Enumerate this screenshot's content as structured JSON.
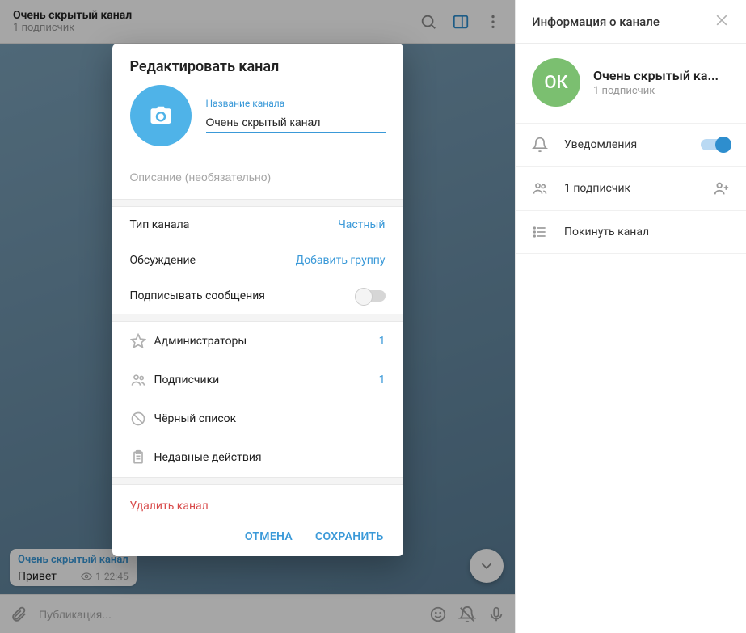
{
  "header": {
    "title": "Очень скрытый канал",
    "subscribers": "1 подписчик"
  },
  "message": {
    "channel": "Очень скрытый канал",
    "text": "Привет",
    "views": "1",
    "time": "22:45"
  },
  "composer": {
    "placeholder": "Публикация..."
  },
  "side": {
    "title": "Информация о канале",
    "avatar_text": "ОК",
    "name": "Очень скрытый ка...",
    "subscribers": "1 подписчик",
    "notifications_label": "Уведомления",
    "subs_row": "1 подписчик",
    "leave": "Покинуть канал"
  },
  "modal": {
    "title": "Редактировать канал",
    "name_label": "Название канала",
    "name_value": "Очень скрытый канал",
    "desc_placeholder": "Описание (необязательно)",
    "type_label": "Тип канала",
    "type_value": "Частный",
    "discussion_label": "Обсуждение",
    "discussion_value": "Добавить группу",
    "sign_label": "Подписывать сообщения",
    "admins_label": "Администраторы",
    "admins_count": "1",
    "subs_label": "Подписчики",
    "subs_count": "1",
    "blacklist_label": "Чёрный список",
    "recent_label": "Недавные действия",
    "delete": "Удалить канал",
    "cancel": "ОТМЕНА",
    "save": "СОХРАНИТЬ"
  }
}
